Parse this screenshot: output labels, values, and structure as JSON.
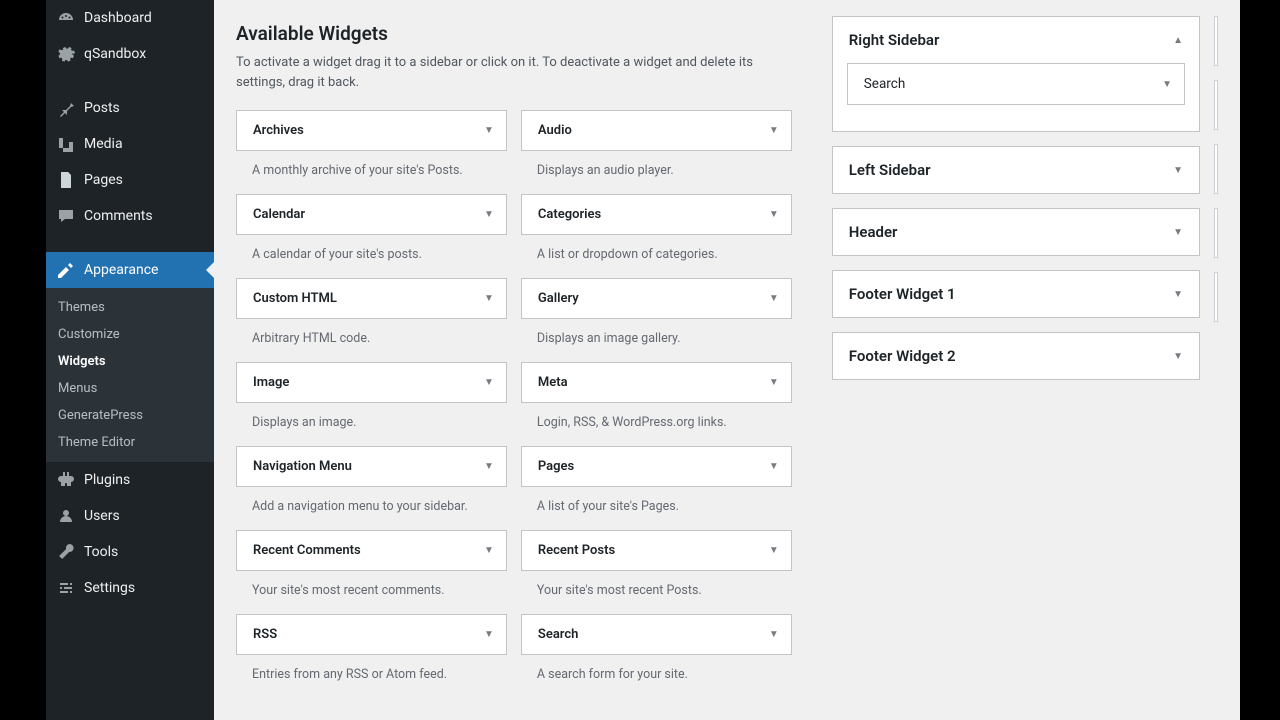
{
  "sidebar": {
    "items": [
      {
        "label": "Dashboard",
        "icon": "dashboard"
      },
      {
        "label": "qSandbox",
        "icon": "generic"
      },
      {
        "label": "Posts",
        "icon": "pin"
      },
      {
        "label": "Media",
        "icon": "media"
      },
      {
        "label": "Pages",
        "icon": "pages"
      },
      {
        "label": "Comments",
        "icon": "comments"
      },
      {
        "label": "Appearance",
        "icon": "appearance",
        "active": true
      },
      {
        "label": "Plugins",
        "icon": "plugins"
      },
      {
        "label": "Users",
        "icon": "users"
      },
      {
        "label": "Tools",
        "icon": "tools"
      },
      {
        "label": "Settings",
        "icon": "settings"
      }
    ],
    "submenu": [
      {
        "label": "Themes"
      },
      {
        "label": "Customize"
      },
      {
        "label": "Widgets",
        "current": true
      },
      {
        "label": "Menus"
      },
      {
        "label": "GeneratePress"
      },
      {
        "label": "Theme Editor"
      }
    ]
  },
  "available": {
    "heading": "Available Widgets",
    "description": "To activate a widget drag it to a sidebar or click on it. To deactivate a widget and delete its settings, drag it back.",
    "widgets": [
      {
        "title": "Archives",
        "desc": "A monthly archive of your site's Posts."
      },
      {
        "title": "Audio",
        "desc": "Displays an audio player."
      },
      {
        "title": "Calendar",
        "desc": "A calendar of your site's posts."
      },
      {
        "title": "Categories",
        "desc": "A list or dropdown of categories."
      },
      {
        "title": "Custom HTML",
        "desc": "Arbitrary HTML code."
      },
      {
        "title": "Gallery",
        "desc": "Displays an image gallery."
      },
      {
        "title": "Image",
        "desc": "Displays an image."
      },
      {
        "title": "Meta",
        "desc": "Login, RSS, & WordPress.org links."
      },
      {
        "title": "Navigation Menu",
        "desc": "Add a navigation menu to your sidebar."
      },
      {
        "title": "Pages",
        "desc": "A list of your site's Pages."
      },
      {
        "title": "Recent Comments",
        "desc": "Your site's most recent comments."
      },
      {
        "title": "Recent Posts",
        "desc": "Your site's most recent Posts."
      },
      {
        "title": "RSS",
        "desc": "Entries from any RSS or Atom feed."
      },
      {
        "title": "Search",
        "desc": "A search form for your site."
      }
    ]
  },
  "areas": [
    {
      "title": "Right Sidebar",
      "expanded": true,
      "widgets": [
        {
          "title": "Search"
        }
      ]
    },
    {
      "title": "Left Sidebar",
      "expanded": false
    },
    {
      "title": "Header",
      "expanded": false
    },
    {
      "title": "Footer Widget 1",
      "expanded": false
    },
    {
      "title": "Footer Widget 2",
      "expanded": false
    }
  ]
}
